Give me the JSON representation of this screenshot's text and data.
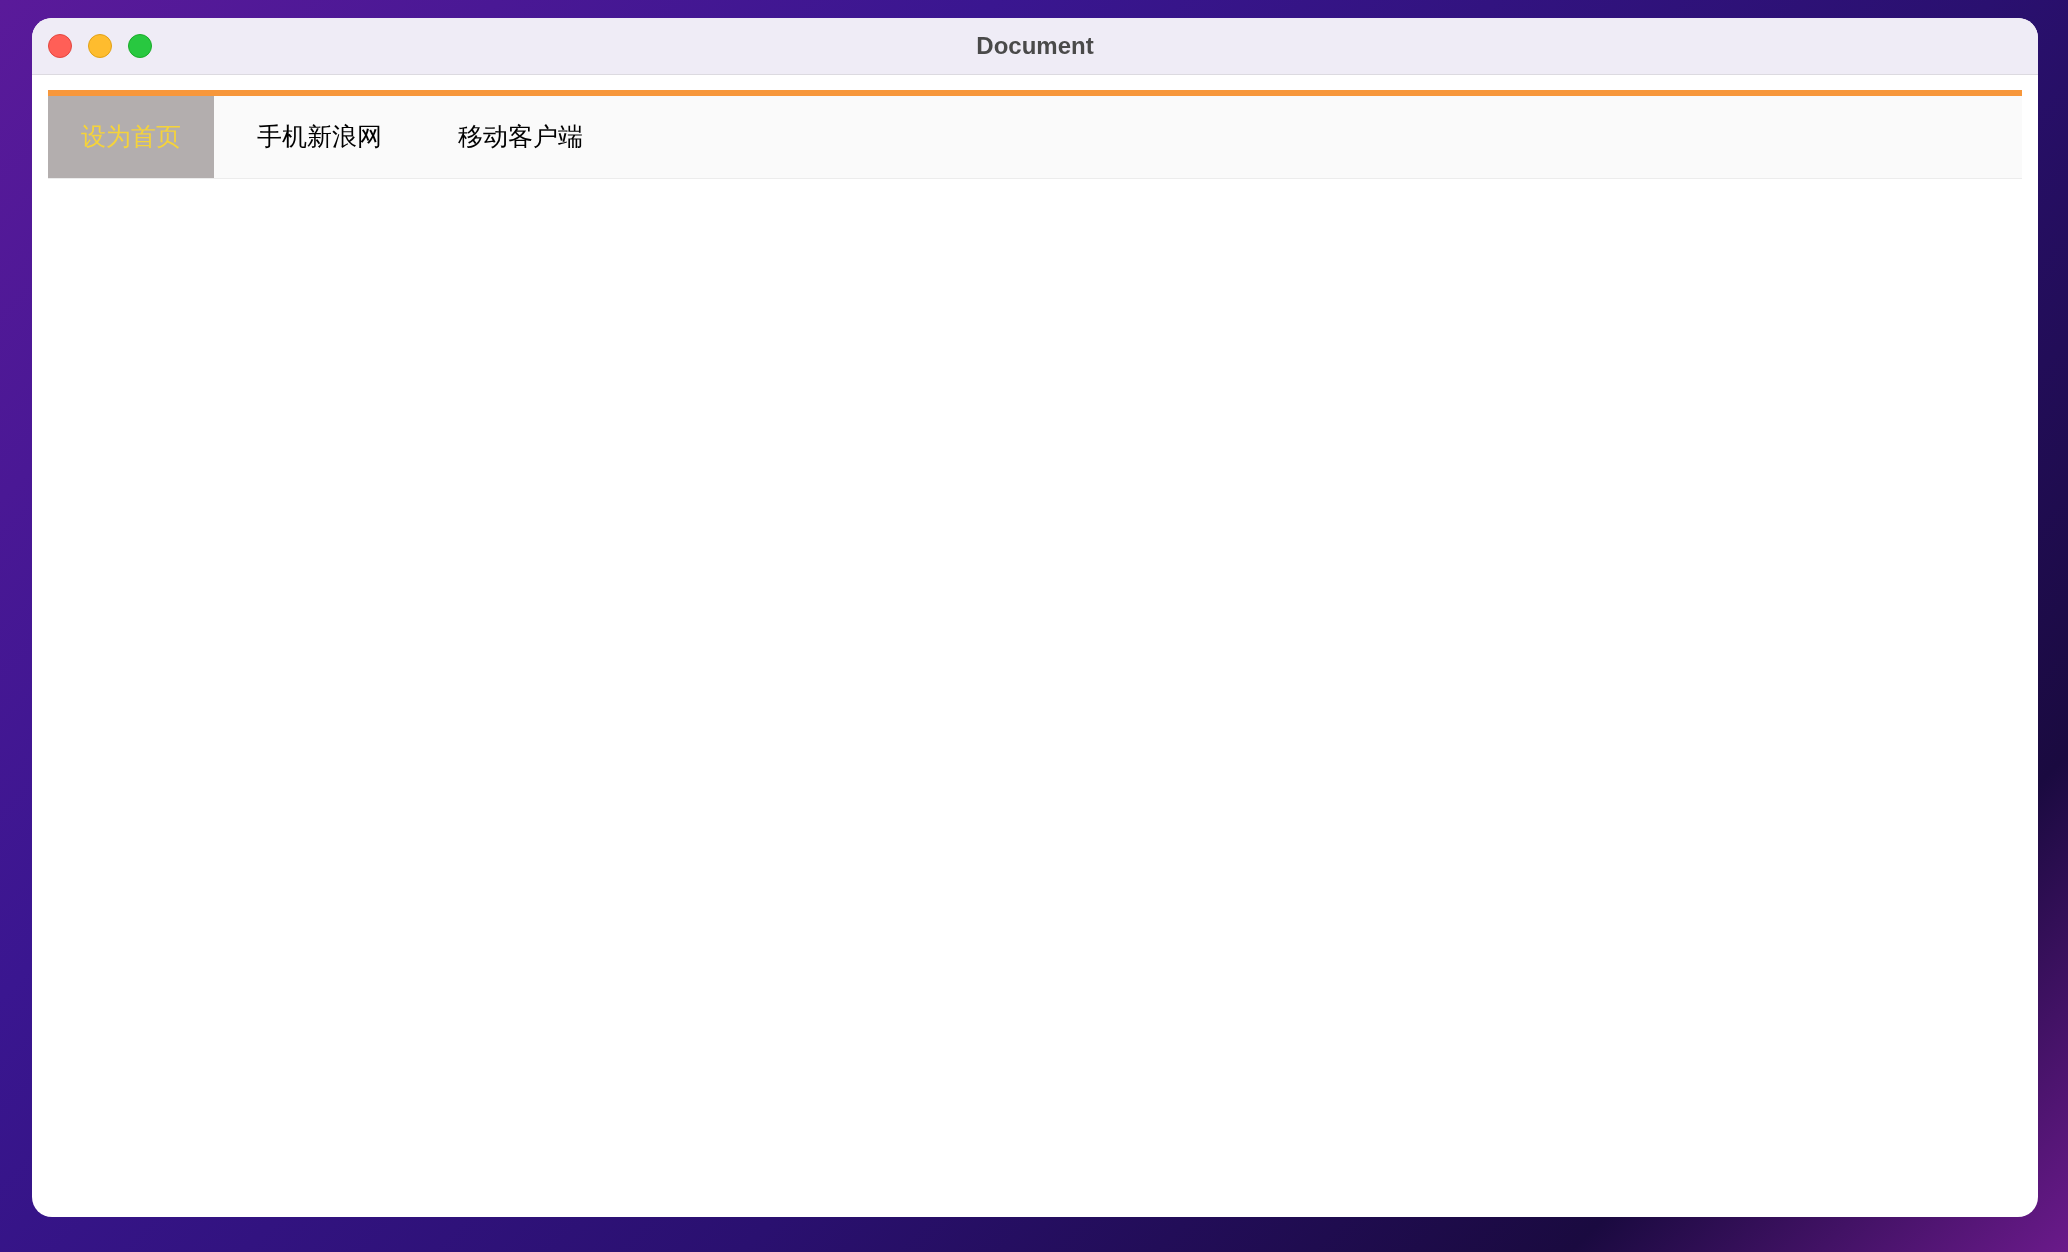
{
  "window": {
    "title": "Document"
  },
  "nav": [
    {
      "label": "设为首页",
      "selected": true
    },
    {
      "label": "手机新浪网",
      "selected": false
    },
    {
      "label": "移动客户端",
      "selected": false
    }
  ]
}
